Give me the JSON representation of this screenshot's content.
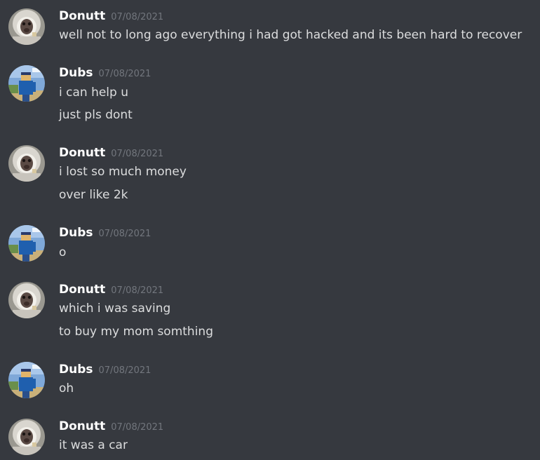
{
  "messages": [
    {
      "author": "Donutt",
      "avatar": "monkey-avatar-icon",
      "timestamp": "07/08/2021",
      "lines": [
        "well not to long ago everything i had got hacked and its been hard to recover"
      ]
    },
    {
      "author": "Dubs",
      "avatar": "blocky-avatar-icon",
      "timestamp": "07/08/2021",
      "lines": [
        "i can help u",
        "just pls dont"
      ]
    },
    {
      "author": "Donutt",
      "avatar": "monkey-avatar-icon",
      "timestamp": "07/08/2021",
      "lines": [
        "i lost so much money",
        "over like 2k"
      ]
    },
    {
      "author": "Dubs",
      "avatar": "blocky-avatar-icon",
      "timestamp": "07/08/2021",
      "lines": [
        "o"
      ]
    },
    {
      "author": "Donutt",
      "avatar": "monkey-avatar-icon",
      "timestamp": "07/08/2021",
      "lines": [
        "which i was saving",
        "to buy my mom somthing"
      ]
    },
    {
      "author": "Dubs",
      "avatar": "blocky-avatar-icon",
      "timestamp": "07/08/2021",
      "lines": [
        "oh"
      ]
    },
    {
      "author": "Donutt",
      "avatar": "monkey-avatar-icon",
      "timestamp": "07/08/2021",
      "lines": [
        "it was a car"
      ]
    }
  ],
  "colors": {
    "background": "#36393f",
    "username": "#ffffff",
    "timestamp": "#72767d",
    "text": "#dcddde"
  }
}
